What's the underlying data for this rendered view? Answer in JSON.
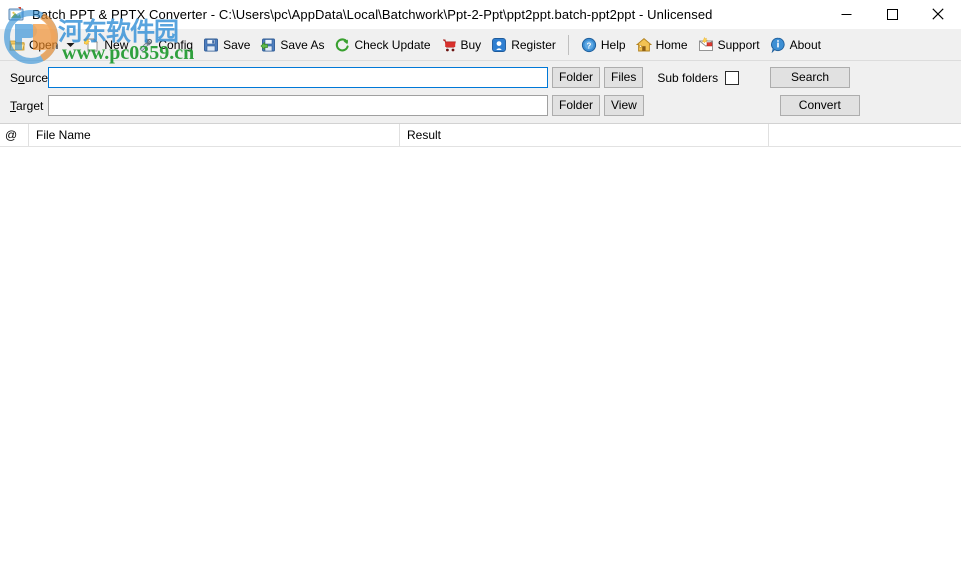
{
  "window": {
    "title": "Batch PPT & PPTX Converter - C:\\Users\\pc\\AppData\\Local\\Batchwork\\Ppt-2-Ppt\\ppt2ppt.batch-ppt2ppt - Unlicensed",
    "app_icon": "app-icon",
    "minimize_label": "─",
    "maximize_label": "□",
    "close_label": "✕"
  },
  "toolbar": {
    "items": [
      {
        "label": "Open",
        "icon": "open-folder-icon",
        "has_caret": true
      },
      {
        "label": "New",
        "icon": "new-document-icon",
        "has_caret": false
      },
      {
        "label": "Config",
        "icon": "config-tools-icon",
        "has_caret": false
      },
      {
        "label": "Save",
        "icon": "save-floppy-icon",
        "has_caret": false
      },
      {
        "label": "Save As",
        "icon": "save-as-icon",
        "has_caret": false
      },
      {
        "label": "Check Update",
        "icon": "refresh-update-icon",
        "has_caret": false
      },
      {
        "label": "Buy",
        "icon": "shopping-cart-icon",
        "has_caret": false
      },
      {
        "label": "Register",
        "icon": "register-key-icon",
        "has_caret": false
      },
      {
        "label": "Help",
        "icon": "help-question-icon",
        "has_caret": false
      },
      {
        "label": "Home",
        "icon": "home-house-icon",
        "has_caret": false
      },
      {
        "label": "Support",
        "icon": "support-mail-icon",
        "has_caret": false
      },
      {
        "label": "About",
        "icon": "about-info-icon",
        "has_caret": false
      }
    ]
  },
  "form": {
    "source": {
      "label_pre": "S",
      "label_accel": "o",
      "label_post": "urce",
      "value": "",
      "placeholder": "",
      "folder_button": "Folder",
      "files_button": "Files",
      "subfolders_label": "Sub folders",
      "subfolders_checked": false,
      "search_button": "Search"
    },
    "target": {
      "label_pre": "",
      "label_accel": "T",
      "label_post": "arget",
      "value": "",
      "placeholder": "",
      "folder_button": "Folder",
      "view_button": "View",
      "convert_button": "Convert"
    }
  },
  "list": {
    "columns": [
      {
        "key": "at",
        "label": "@"
      },
      {
        "key": "file_name",
        "label": "File Name"
      },
      {
        "key": "result",
        "label": "Result"
      }
    ],
    "rows": []
  },
  "watermark": {
    "chinese_text": "河东软件园",
    "url_text": "www.pc0359.cn",
    "logo": "pc0359-logo",
    "blue": "#2f8ed6",
    "green": "#1f9a2e",
    "orange": "#f08a24"
  }
}
